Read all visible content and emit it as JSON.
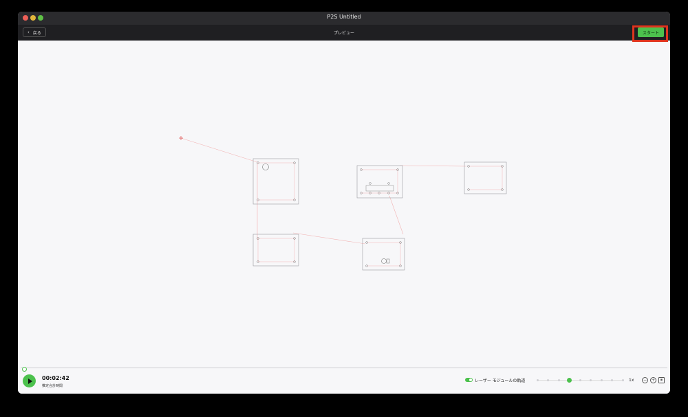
{
  "window": {
    "title": "P2S Untitled"
  },
  "toolbar": {
    "back_label": "戻る",
    "title": "プレビュー",
    "start_label": "スタート"
  },
  "playback": {
    "time": "00:02:42",
    "time_label": "推定合計時間",
    "progress_percent": 0
  },
  "controls": {
    "laser_toggle_label": "レーザー モジュールの軌道",
    "laser_toggle_on": true,
    "speed_level_index": 3,
    "speed_level_count": 9,
    "speed_label": "1x"
  },
  "colors": {
    "accent": "#4cc14d",
    "highlight": "#e0341e",
    "path": "#f2a6a6"
  },
  "icons": [
    "back-chevron-icon",
    "play-icon",
    "zoom-out-icon",
    "zoom-in-icon",
    "fit-view-icon"
  ]
}
